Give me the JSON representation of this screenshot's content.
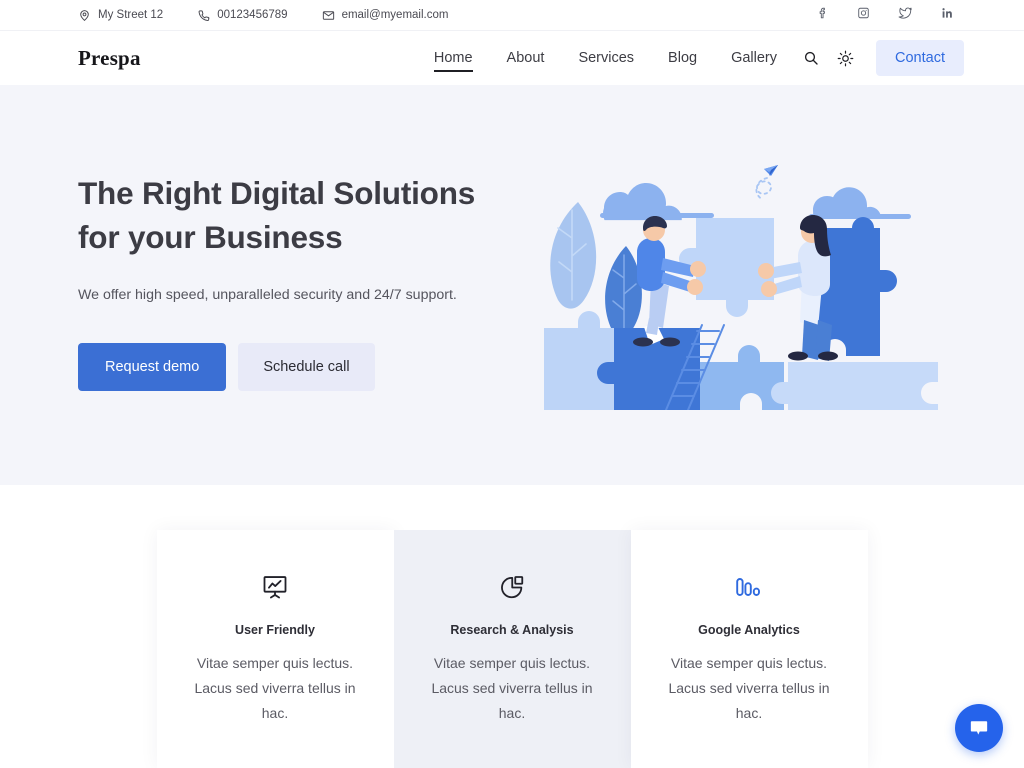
{
  "topbar": {
    "contacts": [
      {
        "icon": "location-pin-icon",
        "text": "My Street 12"
      },
      {
        "icon": "phone-icon",
        "text": "00123456789"
      },
      {
        "icon": "envelope-icon",
        "text": "email@myemail.com"
      }
    ],
    "socials": [
      {
        "icon": "facebook-icon",
        "name": "Facebook"
      },
      {
        "icon": "instagram-icon",
        "name": "Instagram"
      },
      {
        "icon": "twitter-icon",
        "name": "Twitter"
      },
      {
        "icon": "linkedin-icon",
        "name": "LinkedIn"
      }
    ]
  },
  "nav": {
    "logo": "Prespa",
    "links": [
      {
        "label": "Home",
        "active": true
      },
      {
        "label": "About",
        "active": false
      },
      {
        "label": "Services",
        "active": false
      },
      {
        "label": "Blog",
        "active": false
      },
      {
        "label": "Gallery",
        "active": false
      }
    ],
    "search_icon": "search-icon",
    "theme_icon": "sun-icon",
    "contact_label": "Contact"
  },
  "hero": {
    "title_line1": "The Right Digital Solutions",
    "title_line2": "for your Business",
    "subtitle": "We offer high speed, unparalleled security and 24/7 support.",
    "primary_button": "Request demo",
    "secondary_button": "Schedule call",
    "illustration": "teamwork-puzzle-illustration"
  },
  "features": {
    "cards": [
      {
        "icon": "presentation-chart-icon",
        "title": "User Friendly",
        "desc": "Vitae semper quis lectus. Lacus sed viverra tellus in hac.",
        "featured": false
      },
      {
        "icon": "pie-chart-icon",
        "title": "Research & Analysis",
        "desc": "Vitae semper quis lectus. Lacus sed viverra tellus in hac.",
        "featured": true
      },
      {
        "icon": "bar-chart-icon",
        "title": "Google Analytics",
        "desc": "Vitae semper quis lectus. Lacus sed viverra tellus in hac.",
        "featured": false
      }
    ]
  },
  "chat": {
    "icon": "chat-bubble-icon",
    "label": "Chat"
  },
  "colors": {
    "accent_blue": "#3b6fd4",
    "contact_btn_bg": "#e8edfd",
    "contact_btn_text": "#2f6adf",
    "hero_bg": "#f4f5fa",
    "featured_card_bg": "#eef0f6",
    "chat_fab": "#2563eb",
    "heading": "#3c3c44",
    "analytics_icon": "#2f6adf"
  }
}
